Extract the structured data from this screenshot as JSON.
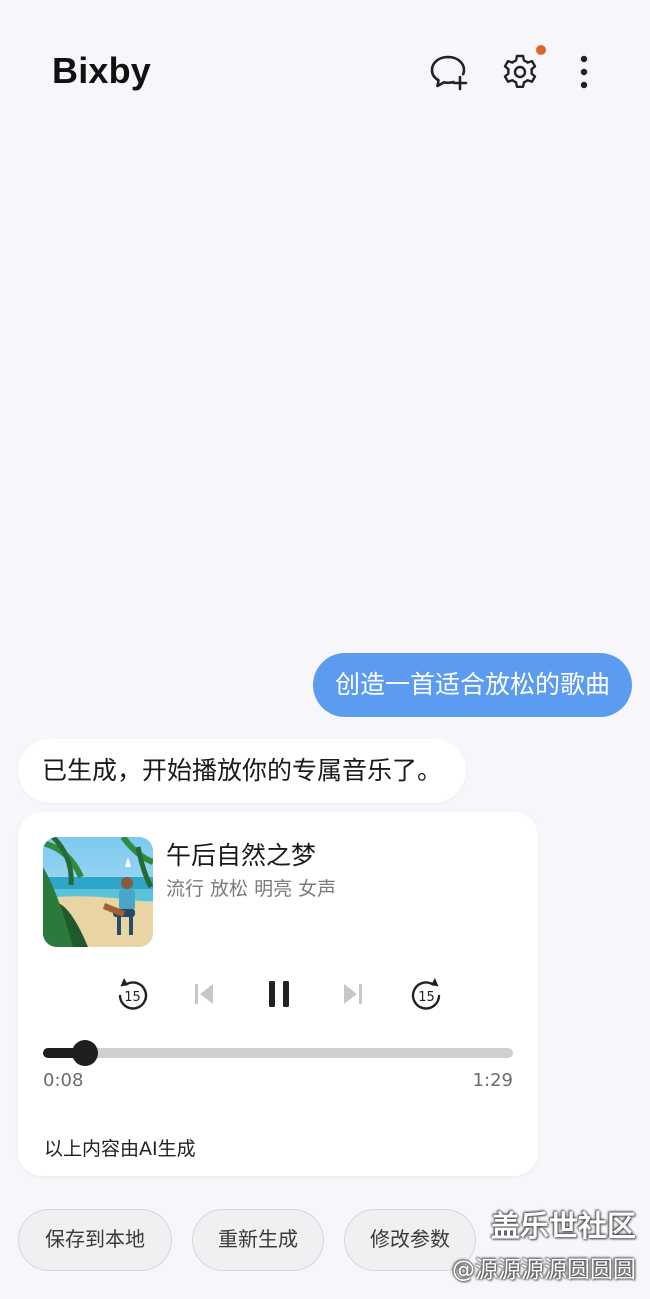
{
  "header": {
    "title": "Bixby",
    "icons": {
      "new_chat": "chat-plus-icon",
      "settings": "gear-icon",
      "more": "more-vertical-icon"
    },
    "settings_badge_color": "#e0652a"
  },
  "conversation": {
    "user_message": "创造一首适合放松的歌曲",
    "assistant_message": "已生成，开始播放你的专属音乐了。"
  },
  "player": {
    "song_title": "午后自然之梦",
    "tags": "流行 放松 明亮 女声",
    "rewind_seconds": "15",
    "forward_seconds": "15",
    "current_time": "0:08",
    "duration": "1:29",
    "progress_fraction": 0.09,
    "state": "playing",
    "ai_notice": "以上内容由AI生成"
  },
  "actions": {
    "save": "保存到本地",
    "regenerate": "重新生成",
    "modify": "修改参数"
  },
  "watermark": {
    "site": "盖乐世社区",
    "user": "@源源源源圆圆圆"
  },
  "colors": {
    "user_bubble": "#5b9cf0",
    "background": "#f7f7fb",
    "accent_dark": "#1e1e1e"
  }
}
